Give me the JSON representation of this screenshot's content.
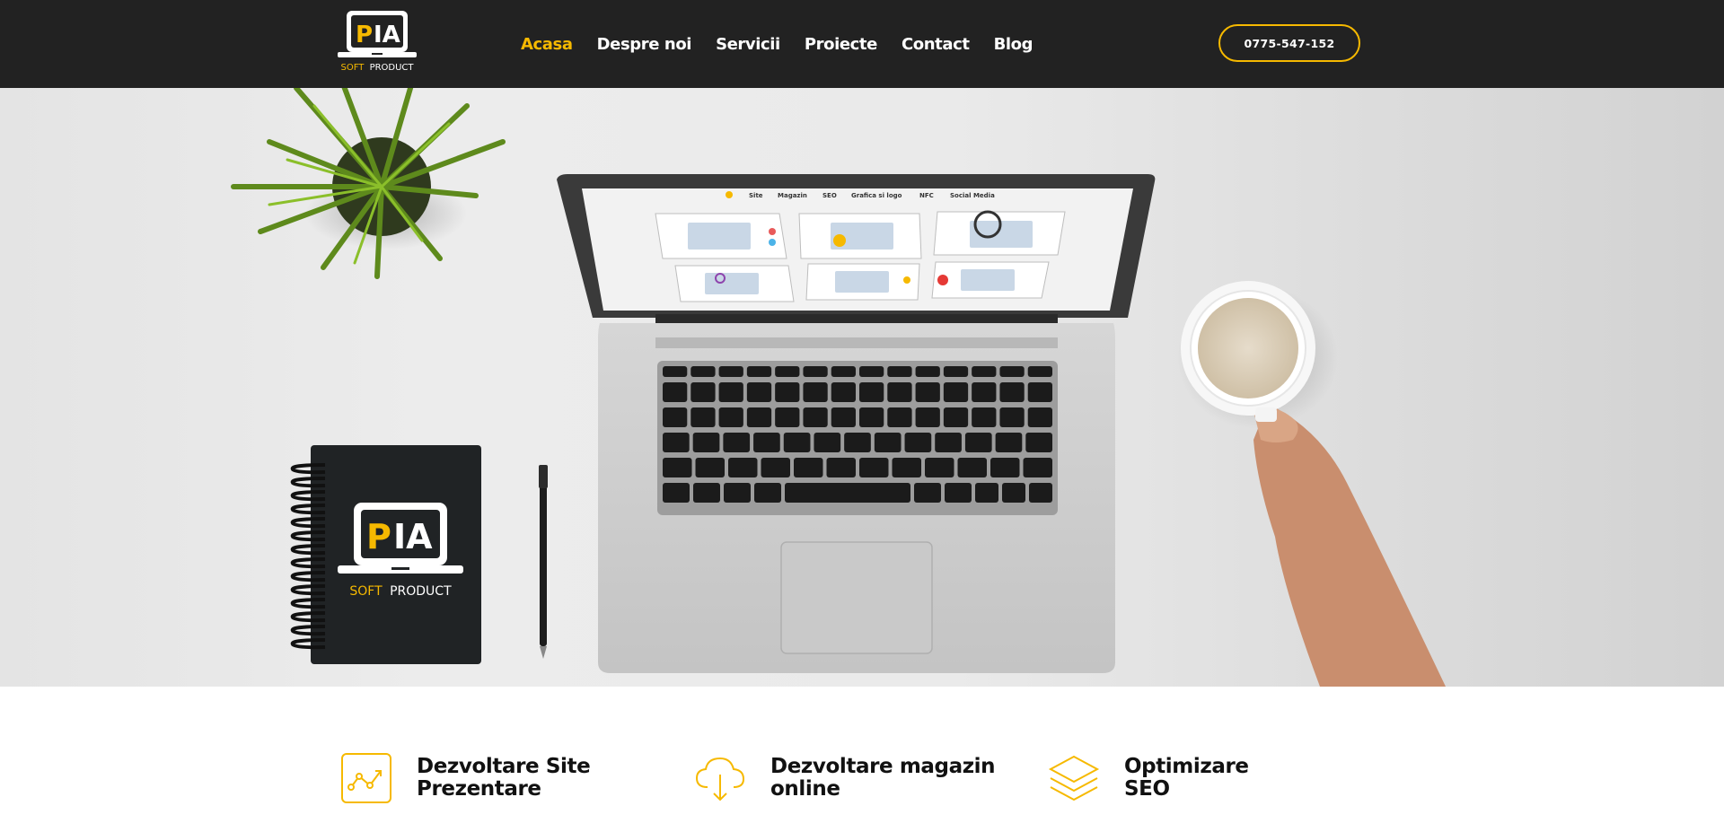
{
  "header": {
    "logo": {
      "letters": "PIA",
      "tagline_part1": "SOFT",
      "tagline_part2": "PRODUCT"
    },
    "nav": [
      {
        "label": "Acasa",
        "active": true
      },
      {
        "label": "Despre noi",
        "active": false
      },
      {
        "label": "Servicii",
        "active": false
      },
      {
        "label": "Proiecte",
        "active": false
      },
      {
        "label": "Contact",
        "active": false
      },
      {
        "label": "Blog",
        "active": false
      }
    ],
    "phone_label": "0775-547-152"
  },
  "hero": {
    "notebook_logo": {
      "letters": "PIA",
      "tagline_part1": "SOFT",
      "tagline_part2": "PRODUCT"
    },
    "laptop_screen_menu": [
      "Site",
      "Magazin",
      "SEO",
      "Grafica si logo",
      "NFC",
      "Social Media"
    ]
  },
  "services": [
    {
      "line1": "Dezvoltare Site",
      "line2": "Prezentare",
      "icon": "chart-growth-icon"
    },
    {
      "line1": "Dezvoltare magazin",
      "line2": "online",
      "icon": "cloud-download-icon"
    },
    {
      "line1": "Optimizare",
      "line2": "SEO",
      "icon": "layers-icon"
    }
  ],
  "colors": {
    "accent": "#f6b900",
    "header_bg": "#222222",
    "text_dark": "#111111"
  }
}
